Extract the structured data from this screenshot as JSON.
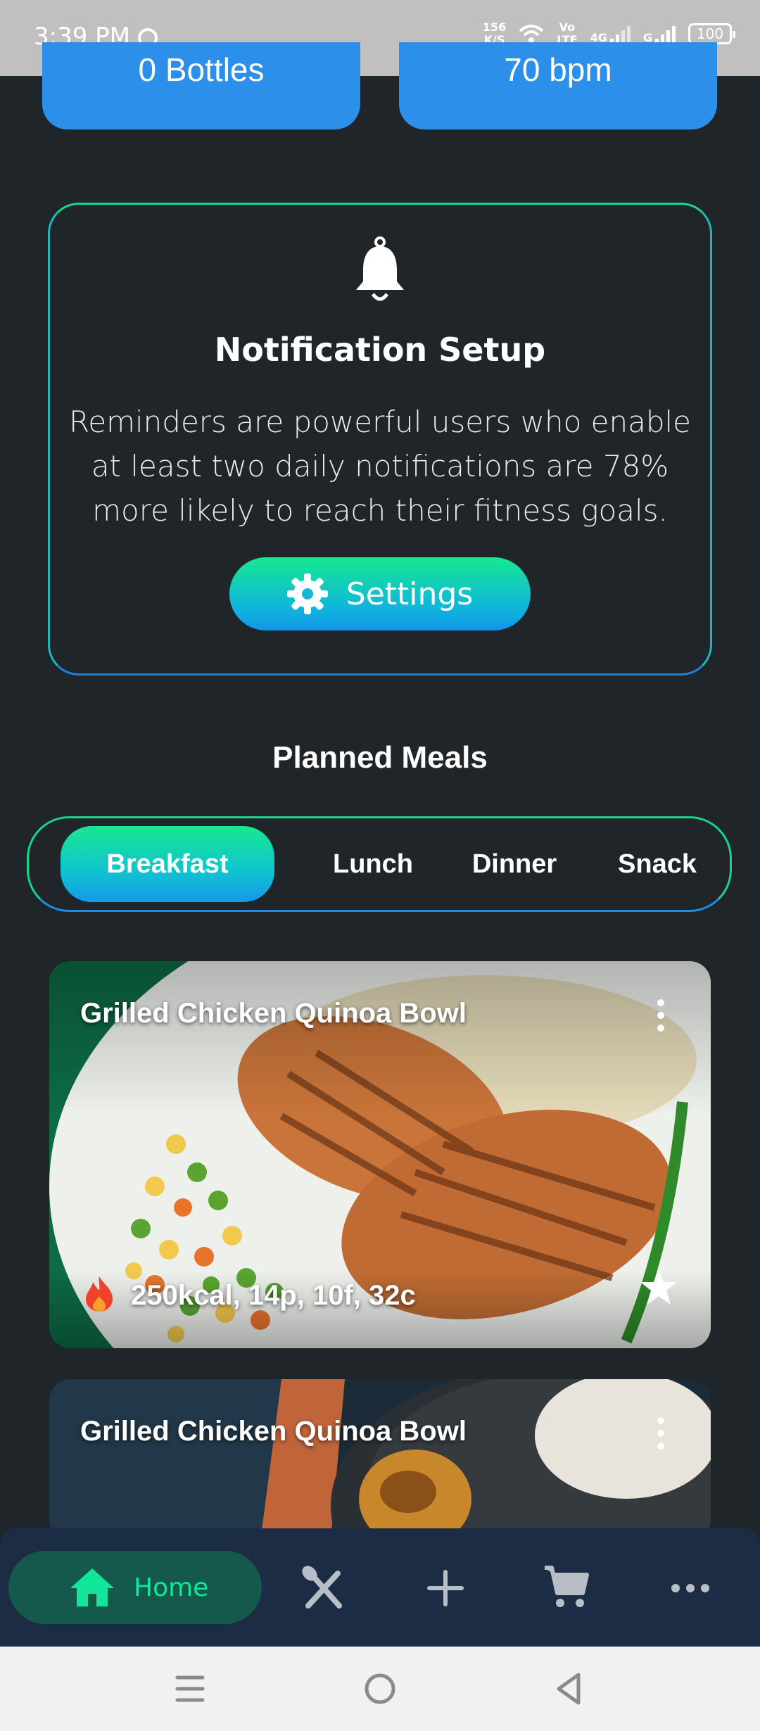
{
  "status_bar": {
    "time": "3:39 PM",
    "net_speed_value": "156",
    "net_speed_unit": "K/S",
    "volte_top": "Vo",
    "volte_bottom": "LTE",
    "network": "4G",
    "network2": "G",
    "battery": "100"
  },
  "stats": {
    "water": "0 Bottles",
    "heart_rate": "70 bpm"
  },
  "notification": {
    "title": "Notification Setup",
    "body": "Reminders are powerful users who enable at least two daily notifications are 78% more likely to reach their fitness goals.",
    "button_label": "Settings",
    "icon": "bell-icon"
  },
  "planned_meals": {
    "title": "Planned Meals",
    "tabs": [
      {
        "label": "Breakfast",
        "active": true
      },
      {
        "label": "Lunch",
        "active": false
      },
      {
        "label": "Dinner",
        "active": false
      },
      {
        "label": "Snack",
        "active": false
      }
    ],
    "meals": [
      {
        "title": "Grilled Chicken Quinoa Bowl",
        "macros": "250kcal, 14p, 10f, 32c",
        "favorite": true
      },
      {
        "title": "Grilled Chicken Quinoa Bowl"
      }
    ]
  },
  "bottom_nav": {
    "items": [
      {
        "label": "Home",
        "icon": "home-icon",
        "active": true
      },
      {
        "label": "",
        "icon": "utensils-icon"
      },
      {
        "label": "",
        "icon": "plus-icon"
      },
      {
        "label": "",
        "icon": "cart-icon"
      },
      {
        "label": "",
        "icon": "more-icon"
      }
    ]
  },
  "colors": {
    "background": "#1f2529",
    "accent_green": "#16e88f",
    "accent_blue": "#1296ea",
    "nav_bg": "#1c2c45",
    "active_nav_text": "#12e69a"
  }
}
